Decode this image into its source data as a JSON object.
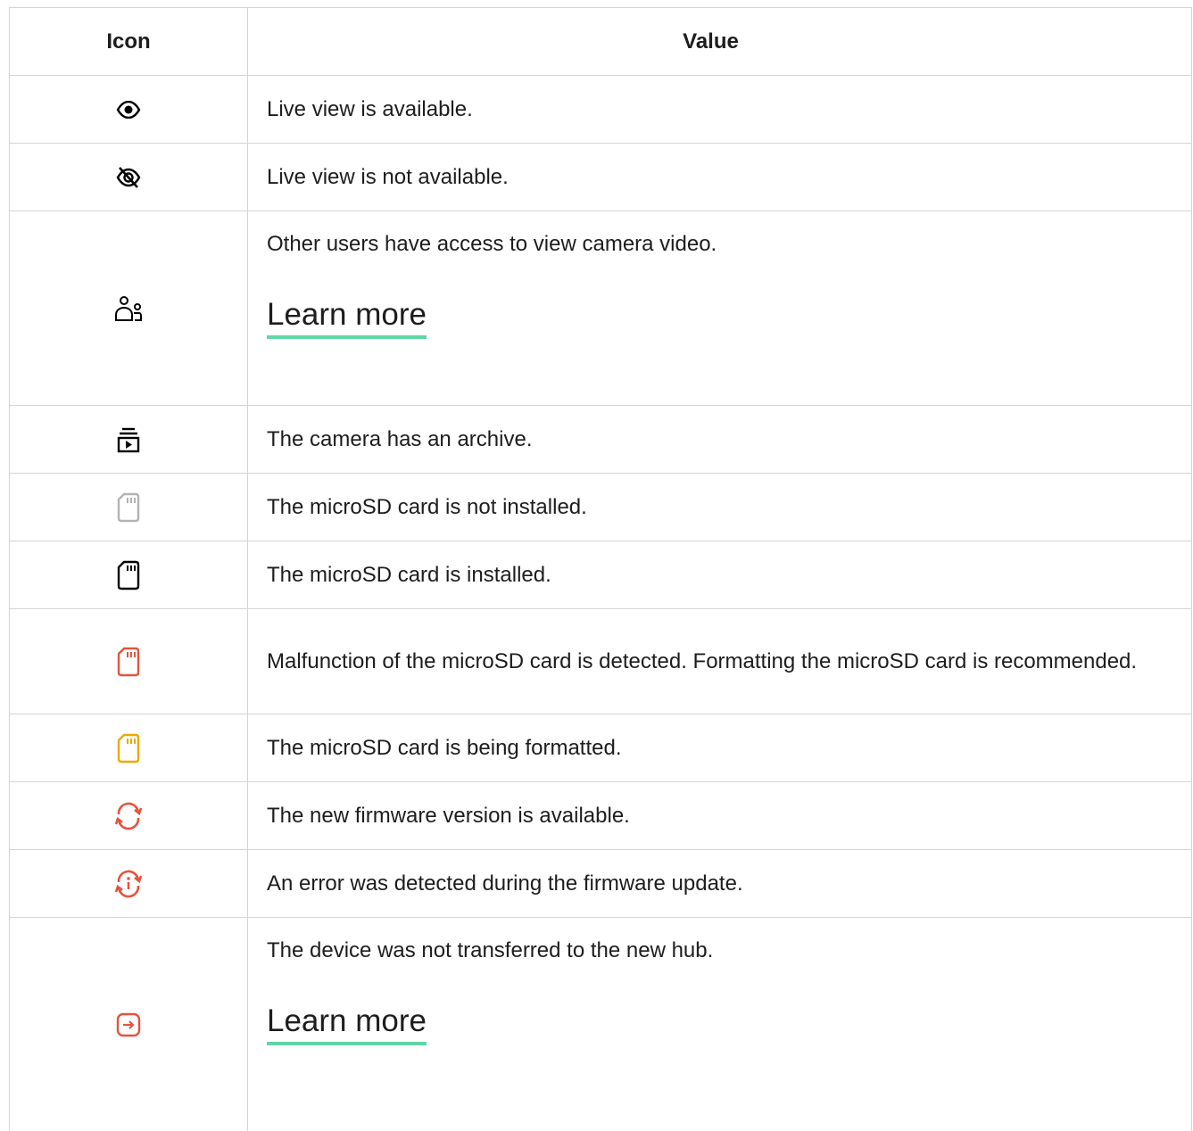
{
  "table": {
    "header": {
      "icon": "Icon",
      "value": "Value"
    },
    "rows": [
      {
        "icon": "eye-icon",
        "color": "#000000",
        "text": "Live view is available."
      },
      {
        "icon": "eye-off-icon",
        "color": "#000000",
        "text": "Live view is not available."
      },
      {
        "icon": "shared-users-icon",
        "color": "#000000",
        "text": "Other users have access to view camera video.",
        "link": "Learn more"
      },
      {
        "icon": "archive-icon",
        "color": "#000000",
        "text": "The camera has an archive."
      },
      {
        "icon": "microsd-not-installed-icon",
        "color": "#b3b3b3",
        "text": "The microSD card is not installed."
      },
      {
        "icon": "microsd-installed-icon",
        "color": "#000000",
        "text": "The microSD card is installed."
      },
      {
        "icon": "microsd-malfunction-icon",
        "color": "#e5533d",
        "text": "Malfunction of the microSD card is detected. Formatting the microSD card is recommended."
      },
      {
        "icon": "microsd-formatting-icon",
        "color": "#eaaa00",
        "text": "The microSD card is being formatted."
      },
      {
        "icon": "firmware-update-icon",
        "color": "#e5533d",
        "text": "The new firmware version is available."
      },
      {
        "icon": "firmware-error-icon",
        "color": "#e5533d",
        "text": "An error was detected during the firmware update."
      },
      {
        "icon": "transfer-failed-icon",
        "color": "#e5533d",
        "text": "The device was not transferred to the new hub.",
        "link": "Learn more"
      }
    ]
  },
  "colors": {
    "border": "#d4d4d4",
    "link_underline": "#5fd6a5"
  }
}
